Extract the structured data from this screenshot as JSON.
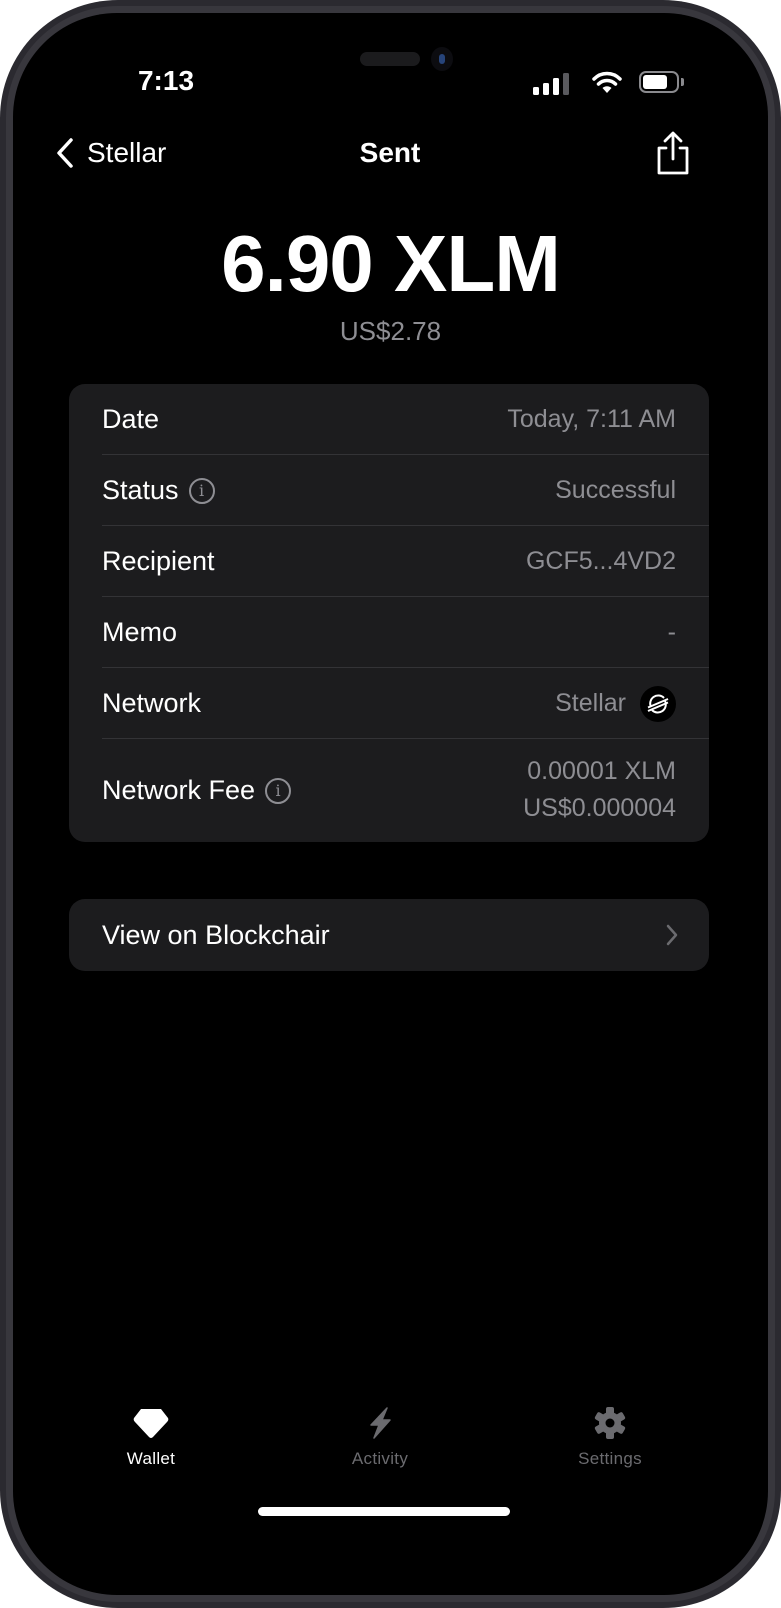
{
  "status_bar": {
    "time": "7:13",
    "signal_icon": "cellular-signal-icon",
    "wifi_icon": "wifi-icon",
    "battery_icon": "battery-icon"
  },
  "nav": {
    "back_label": "Stellar",
    "title": "Sent",
    "share_icon": "share-icon"
  },
  "transaction": {
    "amount": "6.90 XLM",
    "fiat_amount": "US$2.78",
    "details": [
      {
        "label": "Date",
        "value": "Today, 7:11 AM",
        "info": false
      },
      {
        "label": "Status",
        "value": "Successful",
        "info": true
      },
      {
        "label": "Recipient",
        "value": "GCF5...4VD2",
        "info": false
      },
      {
        "label": "Memo",
        "value": "-",
        "info": false
      },
      {
        "label": "Network",
        "value": "Stellar",
        "info": false,
        "icon": "stellar-logo-icon"
      },
      {
        "label": "Network Fee",
        "value": "0.00001 XLM",
        "value_secondary": "US$0.000004",
        "info": true
      }
    ]
  },
  "explorer_link": {
    "label": "View on Blockchair"
  },
  "tab_bar": {
    "tabs": [
      {
        "label": "Wallet",
        "icon": "wallet-gem-icon",
        "active": true
      },
      {
        "label": "Activity",
        "icon": "lightning-bolt-icon",
        "active": false
      },
      {
        "label": "Settings",
        "icon": "gear-icon",
        "active": false
      }
    ]
  },
  "colors": {
    "background": "#000000",
    "card": "#1c1c1e",
    "secondary_text": "#8e8e93",
    "primary_text": "#ffffff",
    "inactive_tab": "#6b6b6f"
  }
}
